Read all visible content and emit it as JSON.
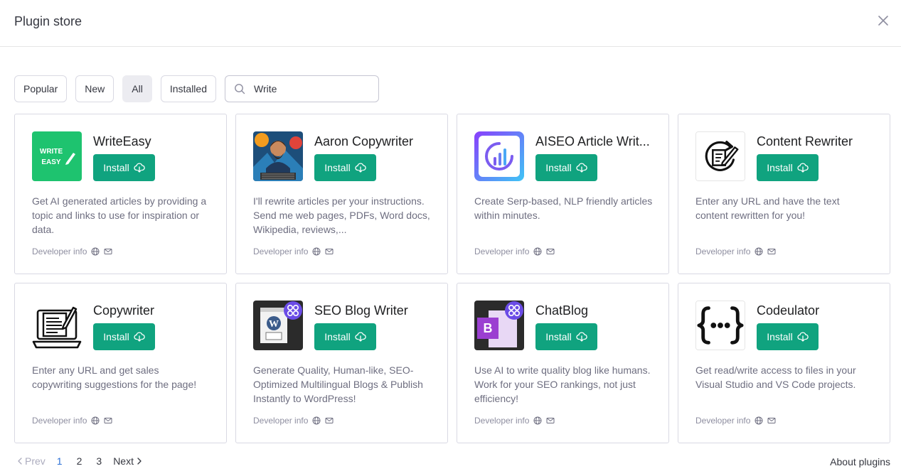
{
  "header": {
    "title": "Plugin store"
  },
  "filters": {
    "popular": "Popular",
    "new": "New",
    "all": "All",
    "installed": "Installed",
    "search_value": "Write"
  },
  "install_label": "Install",
  "developer_info_label": "Developer info",
  "plugins": [
    {
      "name": "WriteEasy",
      "description": "Get AI generated articles by providing a topic and links to use for inspiration or data.",
      "logo_text": "WRITE EASY"
    },
    {
      "name": "Aaron Copywriter",
      "description": "I'll rewrite articles per your instructions. Send me web pages, PDFs, Word docs, Wikipedia, reviews,..."
    },
    {
      "name": "AISEO Article Writ...",
      "description": "Create Serp-based, NLP friendly articles within minutes."
    },
    {
      "name": "Content Rewriter",
      "description": "Enter any URL and have the text content rewritten for you!"
    },
    {
      "name": "Copywriter",
      "description": "Enter any URL and get sales copywriting suggestions for the page!"
    },
    {
      "name": "SEO Blog Writer",
      "description": "Generate Quality, Human-like, SEO-Optimized Multilingual Blogs & Publish Instantly to WordPress!"
    },
    {
      "name": "ChatBlog",
      "description": "Use AI to write quality blog like humans. Work for your SEO rankings, not just efficiency!",
      "logo_text": "B"
    },
    {
      "name": "Codeulator",
      "description": "Get read/write access to files in your Visual Studio and VS Code projects."
    }
  ],
  "pagination": {
    "prev": "Prev",
    "pages": [
      "1",
      "2",
      "3"
    ],
    "current": "1",
    "next": "Next"
  },
  "about": "About plugins",
  "colors": {
    "accent": "#10a37f",
    "page_active": "#2a6fd6"
  },
  "icons": [
    "close-icon",
    "search-icon",
    "cloud-download-icon",
    "globe-icon",
    "mail-icon",
    "chevron-left-icon",
    "chevron-right-icon"
  ]
}
